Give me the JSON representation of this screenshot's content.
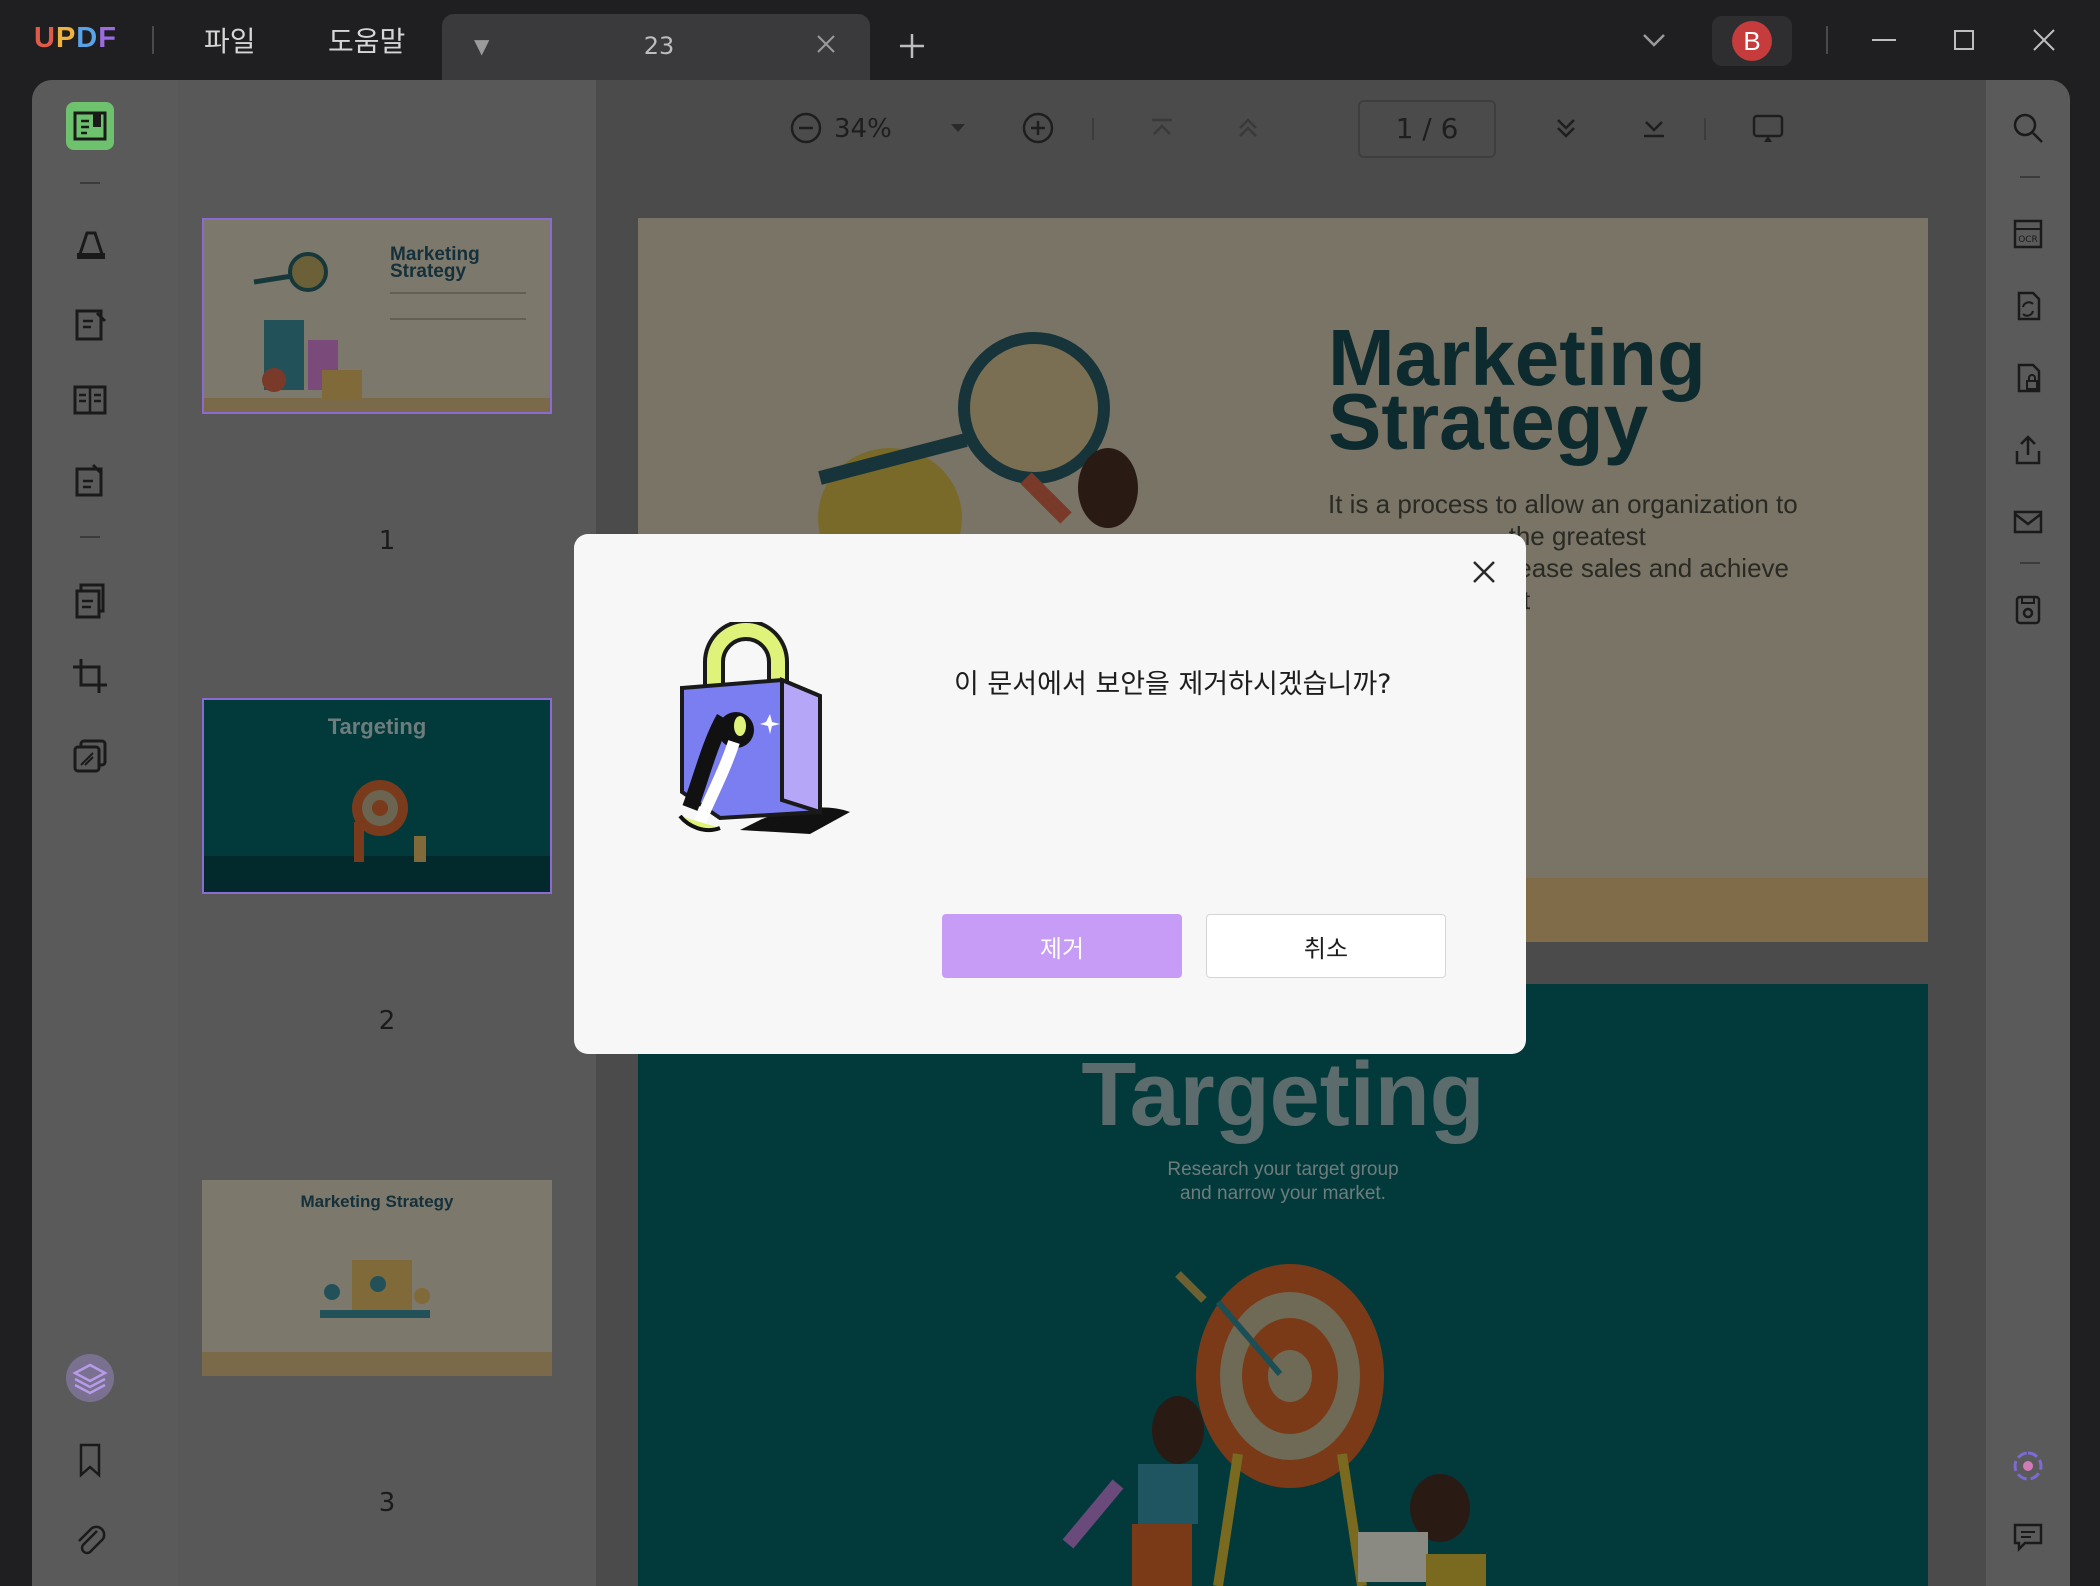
{
  "app": {
    "logo": "UPDF",
    "menu_file": "파일",
    "menu_help": "도움말",
    "tab_title": "23",
    "avatar_letter": "B"
  },
  "toolbar": {
    "zoom": "34%",
    "page_indicator": "1 / 6"
  },
  "thumbnails": [
    {
      "page_label": "1",
      "title": "Marketing Strategy"
    },
    {
      "page_label": "2",
      "title": "Targeting"
    },
    {
      "page_label": "3",
      "title": "Marketing Strategy"
    }
  ],
  "page1": {
    "title_line1": "Marketing",
    "title_line2": "Strategy",
    "body_visible": "It is a process to allow an organization to\n                         the greatest\n                         rease sales and achieve\n                         et"
  },
  "page2": {
    "title": "Targeting",
    "subtitle_line1": "Research your target group",
    "subtitle_line2": "and narrow your market."
  },
  "dialog": {
    "question": "이 문서에서 보안을 제거하시겠습니까?",
    "confirm_label": "제거",
    "cancel_label": "취소"
  },
  "colors": {
    "accent": "#c69cf6",
    "dialog_bg": "#f7f7f7",
    "page2_bg": "#023a3c"
  }
}
